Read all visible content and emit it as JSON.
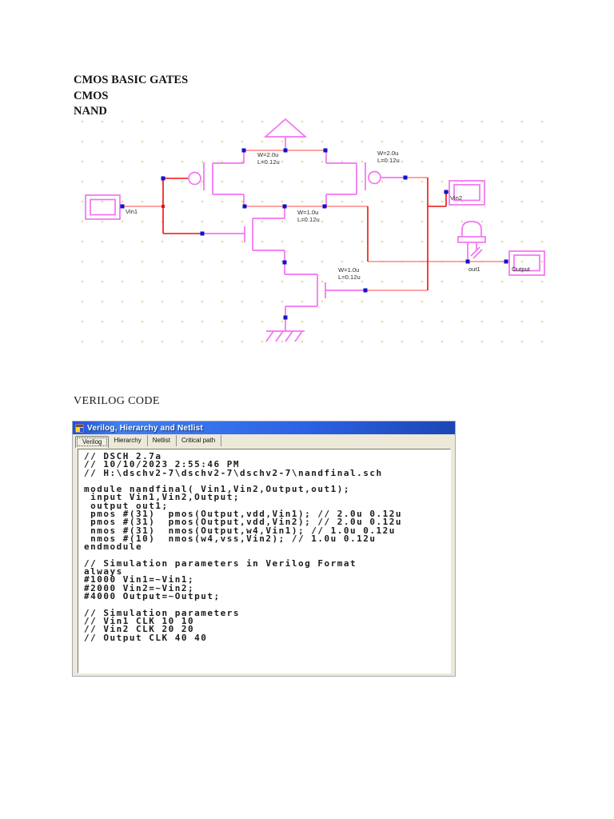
{
  "page": {
    "heading_line1": "CMOS BASIC GATES",
    "heading_line2": "CMOS",
    "heading_line3": "NAND",
    "section2_heading": "VERILOG CODE"
  },
  "schematic": {
    "ports": {
      "in1": "Vin1",
      "in2": "Vin2",
      "node": "out1",
      "out": "Output"
    },
    "transistors": [
      {
        "name": "pmos-1",
        "w": "W=2.0u",
        "l": "L=0.12u"
      },
      {
        "name": "pmos-2",
        "w": "W=2.0u",
        "l": "L=0.12u"
      },
      {
        "name": "nmos-1",
        "w": "W=1.0u",
        "l": "L=0.12u"
      },
      {
        "name": "nmos-2",
        "w": "W=1.0u",
        "l": "L=0.12u"
      }
    ],
    "colors": {
      "component": "#f273f2",
      "wire": "#ff8585",
      "wire_strong": "#ee1111",
      "junction": "#1111cc",
      "grid_dot": "#dfdf9b",
      "label": "#2a2a2a"
    }
  },
  "window": {
    "title": "Verilog, Hierarchy and Netlist",
    "tabs": [
      {
        "label": "Verilog",
        "active": true
      },
      {
        "label": "Hierarchy",
        "active": false
      },
      {
        "label": "Netlist",
        "active": false
      },
      {
        "label": "Critical path",
        "active": false
      }
    ],
    "code_lines": [
      "// DSCH 2.7a",
      "// 10/10/2023 2:55:46 PM",
      "// H:\\dschv2-7\\dschv2-7\\dschv2-7\\nandfinal.sch",
      "",
      "module nandfinal( Vin1,Vin2,Output,out1);",
      " input Vin1,Vin2,Output;",
      " output out1;",
      " pmos #(31)  pmos(Output,vdd,Vin1); // 2.0u 0.12u",
      " pmos #(31)  pmos(Output,vdd,Vin2); // 2.0u 0.12u",
      " nmos #(31)  nmos(Output,w4,Vin1); // 1.0u 0.12u",
      " nmos #(10)  nmos(w4,vss,Vin2); // 1.0u 0.12u",
      "endmodule",
      "",
      "// Simulation parameters in Verilog Format",
      "always",
      "#1000 Vin1=~Vin1;",
      "#2000 Vin2=~Vin2;",
      "#4000 Output=~Output;",
      "",
      "// Simulation parameters",
      "// Vin1 CLK 10 10",
      "// Vin2 CLK 20 20",
      "// Output CLK 40 40"
    ]
  }
}
